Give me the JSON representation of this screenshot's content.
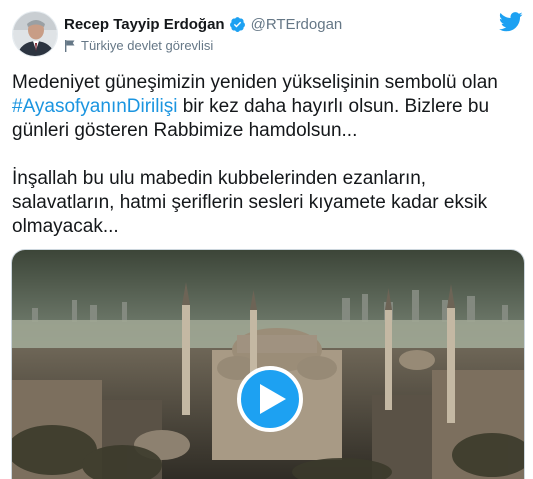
{
  "author": {
    "display_name": "Recep Tayyip Erdoğan",
    "handle": "@RTErdogan",
    "verified": true,
    "label": "Türkiye devlet görevlisi",
    "avatar_icon": "avatar"
  },
  "tweet": {
    "paragraph1_before": "Medeniyet güneşimizin yeniden yükselişinin sembolü olan ",
    "hashtag": "#AyasofyanınDirilişi",
    "paragraph1_after": " bir kez daha hayırlı olsun. Bizlere bu günleri gösteren Rabbimize hamdolsun...",
    "paragraph2": "İnşallah bu ulu mabedin kubbelerinden ezanların, salavatların, hatmi şeriflerin sesleri kıyamete kadar eksik olmayacak..."
  },
  "media": {
    "type": "video",
    "play_icon": "play-icon"
  },
  "colors": {
    "accent": "#1da1f2",
    "hashtag": "#1b95e0",
    "secondary_text": "#657786"
  },
  "icons": {
    "verified": "verified-badge-icon",
    "government_label": "flag-icon",
    "brand": "twitter-bird-icon"
  }
}
